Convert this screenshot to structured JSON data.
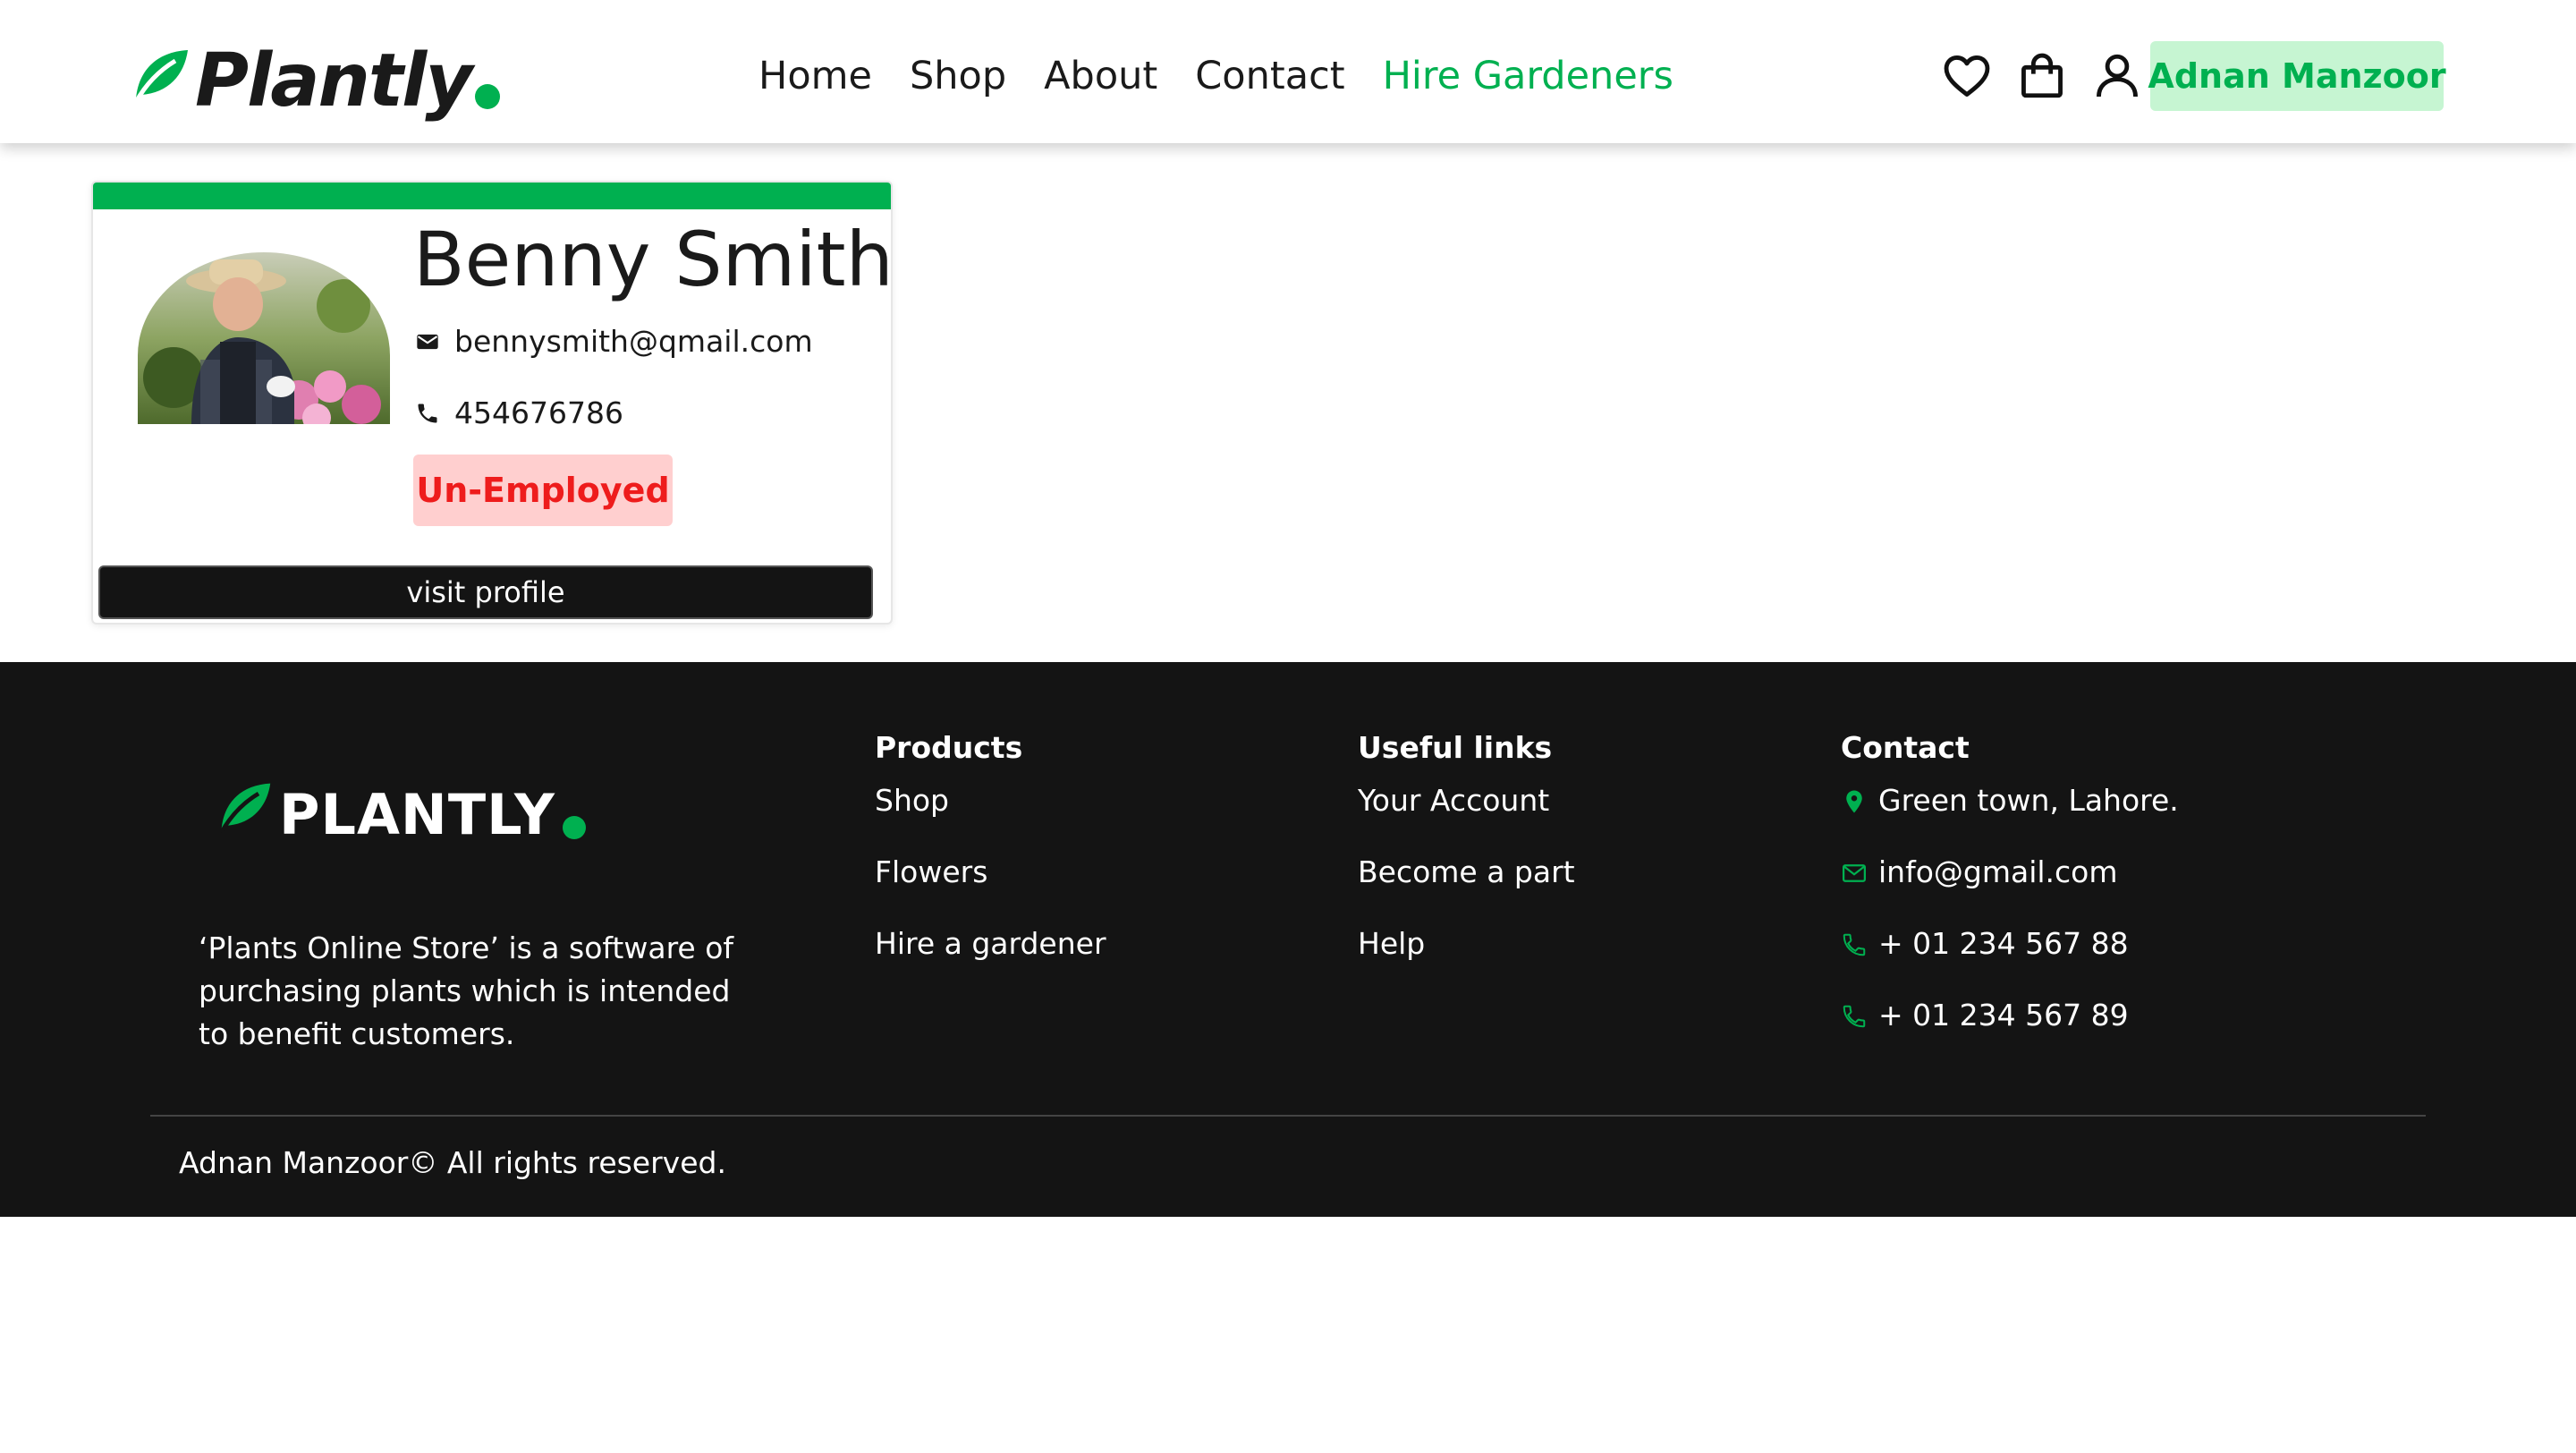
{
  "header": {
    "logo_text": "Plantly",
    "nav": [
      {
        "label": "Home",
        "active": false
      },
      {
        "label": "Shop",
        "active": false
      },
      {
        "label": "About",
        "active": false
      },
      {
        "label": "Contact",
        "active": false
      },
      {
        "label": "Hire Gardeners",
        "active": true
      }
    ],
    "icons": [
      "heart-icon",
      "shopping-bag-icon",
      "user-icon"
    ],
    "user_name": "Adnan Manzoor"
  },
  "gardener_card": {
    "name": "Benny Smith",
    "email": "bennysmith@qmail.com",
    "phone": "454676786",
    "status": "Un-Employed",
    "button_label": "visit profile"
  },
  "footer": {
    "logo_text": "PLANTLY",
    "description": "‘Plants Online Store’ is a software of purchasing plants which is intended to benefit customers.",
    "products": {
      "title": "Products",
      "items": [
        "Shop",
        "Flowers",
        "Hire a gardener"
      ]
    },
    "useful_links": {
      "title": "Useful links",
      "items": [
        "Your Account",
        "Become a part",
        "Help"
      ]
    },
    "contact": {
      "title": "Contact",
      "address": "Green town, Lahore.",
      "email": "info@gmail.com",
      "phone1": "+ 01 234 567 88",
      "phone2": "+ 01 234 567 89"
    },
    "copyright": "Adnan Manzoor© All rights reserved."
  },
  "colors": {
    "brand_green": "#00b050",
    "badge_green_bg": "#c6f5d2",
    "status_red": "#ee1c1c",
    "status_red_bg": "#ffcfcf",
    "footer_bg": "#141414"
  }
}
